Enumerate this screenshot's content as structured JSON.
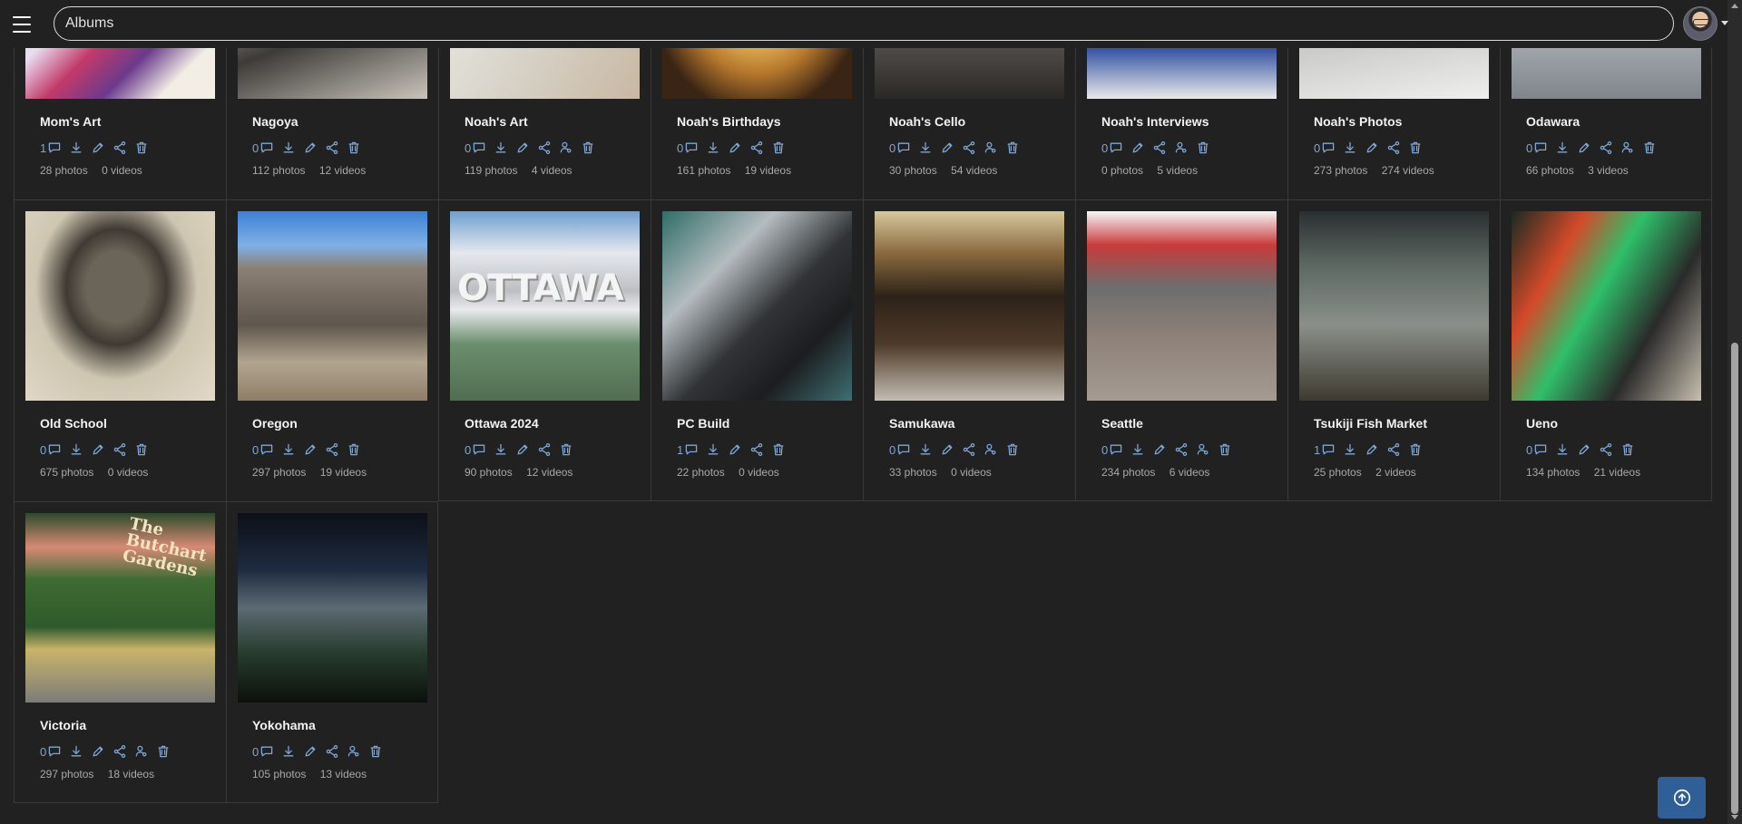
{
  "search": {
    "value": "Albums"
  },
  "albums": [
    {
      "title": "Mom's Art",
      "comments": "1",
      "photos": "28 photos",
      "videos": "0 videos",
      "thumb": "t-momsart",
      "hasUserIcon": false
    },
    {
      "title": "Nagoya",
      "comments": "0",
      "photos": "112 photos",
      "videos": "12 videos",
      "thumb": "t-nagoya",
      "hasUserIcon": false
    },
    {
      "title": "Noah's Art",
      "comments": "0",
      "photos": "119 photos",
      "videos": "4 videos",
      "thumb": "t-noahsart",
      "hasUserIcon": true
    },
    {
      "title": "Noah's Birthdays",
      "comments": "0",
      "photos": "161 photos",
      "videos": "19 videos",
      "thumb": "t-noahsbday",
      "hasUserIcon": false
    },
    {
      "title": "Noah's Cello",
      "comments": "0",
      "photos": "30 photos",
      "videos": "54 videos",
      "thumb": "t-cello",
      "hasUserIcon": true
    },
    {
      "title": "Noah's Interviews",
      "comments": "0",
      "photos": "0 photos",
      "videos": "5 videos",
      "thumb": "t-interviews",
      "hasUserIcon": true,
      "noDownload": true
    },
    {
      "title": "Noah's Photos",
      "comments": "0",
      "photos": "273 photos",
      "videos": "274 videos",
      "thumb": "t-noahsphotos",
      "hasUserIcon": false
    },
    {
      "title": "Odawara",
      "comments": "0",
      "photos": "66 photos",
      "videos": "3 videos",
      "thumb": "t-odawara",
      "hasUserIcon": true
    },
    {
      "title": "Old School",
      "comments": "0",
      "photos": "675 photos",
      "videos": "0 videos",
      "thumb": "t-oldschool",
      "hasUserIcon": false
    },
    {
      "title": "Oregon",
      "comments": "0",
      "photos": "297 photos",
      "videos": "19 videos",
      "thumb": "t-oregon",
      "hasUserIcon": false
    },
    {
      "title": "Ottawa 2024",
      "comments": "0",
      "photos": "90 photos",
      "videos": "12 videos",
      "thumb": "t-ottawa",
      "hasUserIcon": false,
      "overlay": "OTTAWA"
    },
    {
      "title": "PC Build",
      "comments": "1",
      "photos": "22 photos",
      "videos": "0 videos",
      "thumb": "t-pcbuild",
      "hasUserIcon": false
    },
    {
      "title": "Samukawa",
      "comments": "0",
      "photos": "33 photos",
      "videos": "0 videos",
      "thumb": "t-samukawa",
      "hasUserIcon": true
    },
    {
      "title": "Seattle",
      "comments": "0",
      "photos": "234 photos",
      "videos": "6 videos",
      "thumb": "t-seattle",
      "hasUserIcon": true
    },
    {
      "title": "Tsukiji Fish Market",
      "comments": "1",
      "photos": "25 photos",
      "videos": "2 videos",
      "thumb": "t-tsukiji",
      "hasUserIcon": false
    },
    {
      "title": "Ueno",
      "comments": "0",
      "photos": "134 photos",
      "videos": "21 videos",
      "thumb": "t-ueno",
      "hasUserIcon": false
    },
    {
      "title": "Victoria",
      "comments": "0",
      "photos": "297 photos",
      "videos": "18 videos",
      "thumb": "t-victoria",
      "hasUserIcon": true,
      "overlay": "The Butchart Gardens"
    },
    {
      "title": "Yokohama",
      "comments": "0",
      "photos": "105 photos",
      "videos": "13 videos",
      "thumb": "t-yokohama",
      "hasUserIcon": true
    }
  ],
  "icons": {
    "menu": "menu-icon",
    "comment": "comment-icon",
    "download": "download-icon",
    "edit": "pencil-icon",
    "share": "share-icon",
    "user": "user-settings-icon",
    "delete": "trash-icon",
    "scroll_top": "arrow-up-circle-icon"
  },
  "colors": {
    "accent": "#7fa6d6",
    "background": "#212121",
    "fab": "#2f5f96"
  }
}
